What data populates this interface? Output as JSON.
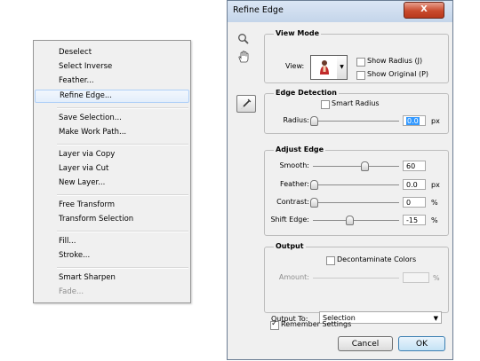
{
  "context_menu": {
    "items": [
      {
        "label": "Deselect"
      },
      {
        "label": "Select Inverse"
      },
      {
        "label": "Feather..."
      },
      {
        "label": "Refine Edge..."
      },
      {
        "label": "Save Selection..."
      },
      {
        "label": "Make Work Path..."
      },
      {
        "label": "Layer via Copy"
      },
      {
        "label": "Layer via Cut"
      },
      {
        "label": "New Layer..."
      },
      {
        "label": "Free Transform"
      },
      {
        "label": "Transform Selection"
      },
      {
        "label": "Fill..."
      },
      {
        "label": "Stroke..."
      },
      {
        "label": "Smart Sharpen"
      },
      {
        "label": "Fade..."
      }
    ],
    "highlighted": "Refine Edge...",
    "disabled": [
      "Fade..."
    ]
  },
  "dialog": {
    "title": "Refine Edge",
    "close_label": "X",
    "view_mode": {
      "heading": "View Mode",
      "view_label": "View:",
      "show_radius_label": "Show Radius (J)",
      "show_radius_checked": false,
      "show_original_label": "Show Original (P)",
      "show_original_checked": false
    },
    "edge_detection": {
      "heading": "Edge Detection",
      "smart_radius_label": "Smart Radius",
      "smart_radius_checked": false,
      "radius_label": "Radius:",
      "radius_value": "0.0",
      "radius_unit": "px",
      "radius_slider": 0.0
    },
    "adjust_edge": {
      "heading": "Adjust Edge",
      "smooth_label": "Smooth:",
      "smooth_value": "60",
      "smooth_slider": 0.6,
      "feather_label": "Feather:",
      "feather_value": "0.0",
      "feather_unit": "px",
      "feather_slider": 0.0,
      "contrast_label": "Contrast:",
      "contrast_value": "0",
      "contrast_unit": "%",
      "contrast_slider": 0.0,
      "shift_label": "Shift Edge:",
      "shift_value": "-15",
      "shift_unit": "%",
      "shift_slider": 0.425
    },
    "output": {
      "heading": "Output",
      "decontaminate_label": "Decontaminate Colors",
      "decontaminate_checked": false,
      "amount_label": "Amount:",
      "amount_value": "",
      "amount_unit": "%",
      "output_to_label": "Output To:",
      "output_to_value": "Selection"
    },
    "remember_label": "Remember Settings",
    "remember_checked": true,
    "cancel_label": "Cancel",
    "ok_label": "OK"
  },
  "icons": [
    "zoom-icon",
    "hand-icon",
    "refine-radius-brush-icon",
    "layer-preview-icon",
    "close-icon",
    "dropdown-arrow-icon"
  ]
}
